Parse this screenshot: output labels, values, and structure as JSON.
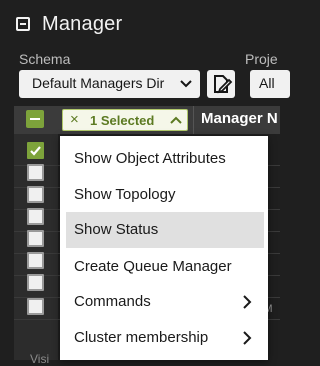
{
  "header": {
    "title": "Manager"
  },
  "schema": {
    "label": "Schema",
    "value": "Default Managers Dir"
  },
  "project": {
    "label": "Proje",
    "value": "All"
  },
  "table": {
    "selected_label": "1 Selected",
    "col_manager": "Manager N",
    "partial_cell": "AM",
    "partial_bottom": "Visi"
  },
  "menu": {
    "items": [
      {
        "label": "Show Object Attributes"
      },
      {
        "label": "Show Topology"
      },
      {
        "label": "Show Status"
      },
      {
        "label": "Create Queue Manager"
      },
      {
        "label": "Commands"
      },
      {
        "label": "Cluster membership"
      }
    ]
  },
  "colors": {
    "accent": "#7da33b",
    "chip_text": "#5c7a22",
    "menu_highlight": "#e0e0e0"
  }
}
